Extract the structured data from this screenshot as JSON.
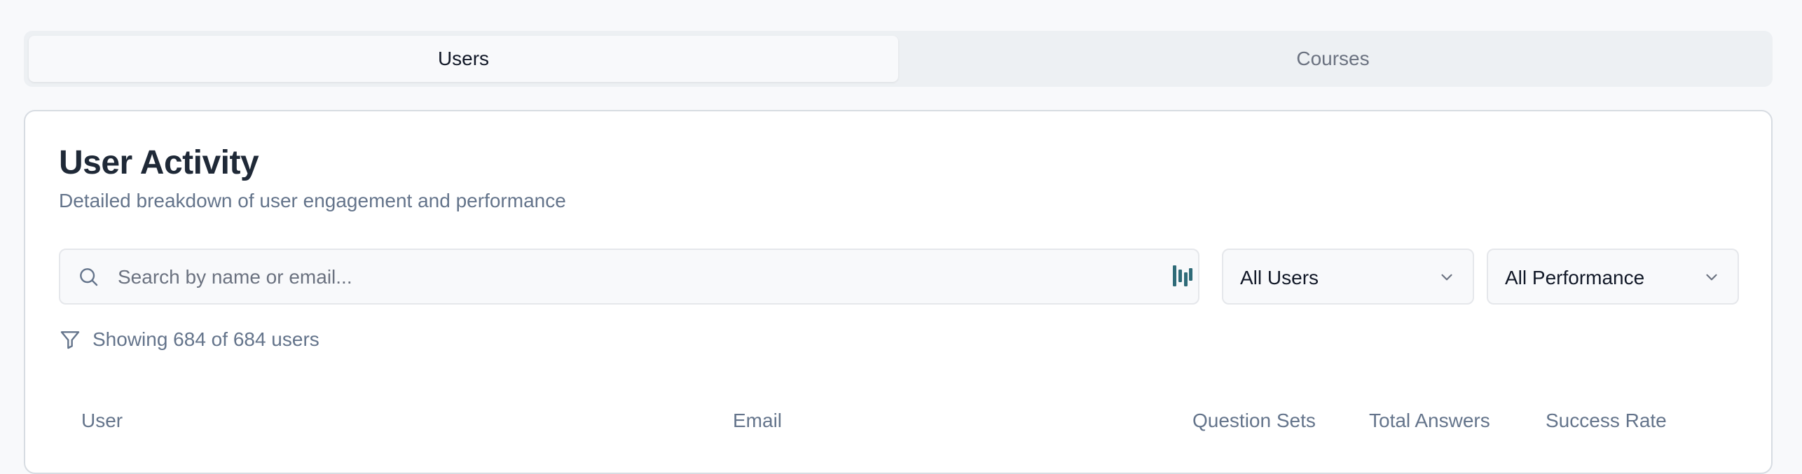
{
  "tabs": [
    {
      "label": "Users",
      "active": true
    },
    {
      "label": "Courses",
      "active": false
    }
  ],
  "card": {
    "title": "User Activity",
    "subtitle": "Detailed breakdown of user engagement and performance"
  },
  "search": {
    "placeholder": "Search by name or email...",
    "value": "",
    "icon": "search-icon",
    "extension_icon": "password-manager-icon"
  },
  "filters": {
    "user_filter": {
      "selected": "All Users"
    },
    "performance_filter": {
      "selected": "All Performance"
    }
  },
  "summary": {
    "icon": "filter-icon",
    "text": "Showing 684 of 684 users"
  },
  "table": {
    "columns": [
      "User",
      "Email",
      "Question Sets",
      "Total Answers",
      "Success Rate"
    ]
  },
  "colors": {
    "background": "#f8f9fb",
    "text_primary": "#1f2937",
    "text_muted": "#64748b",
    "border": "#e5e7eb",
    "extension_icon": "#2f6b78"
  }
}
